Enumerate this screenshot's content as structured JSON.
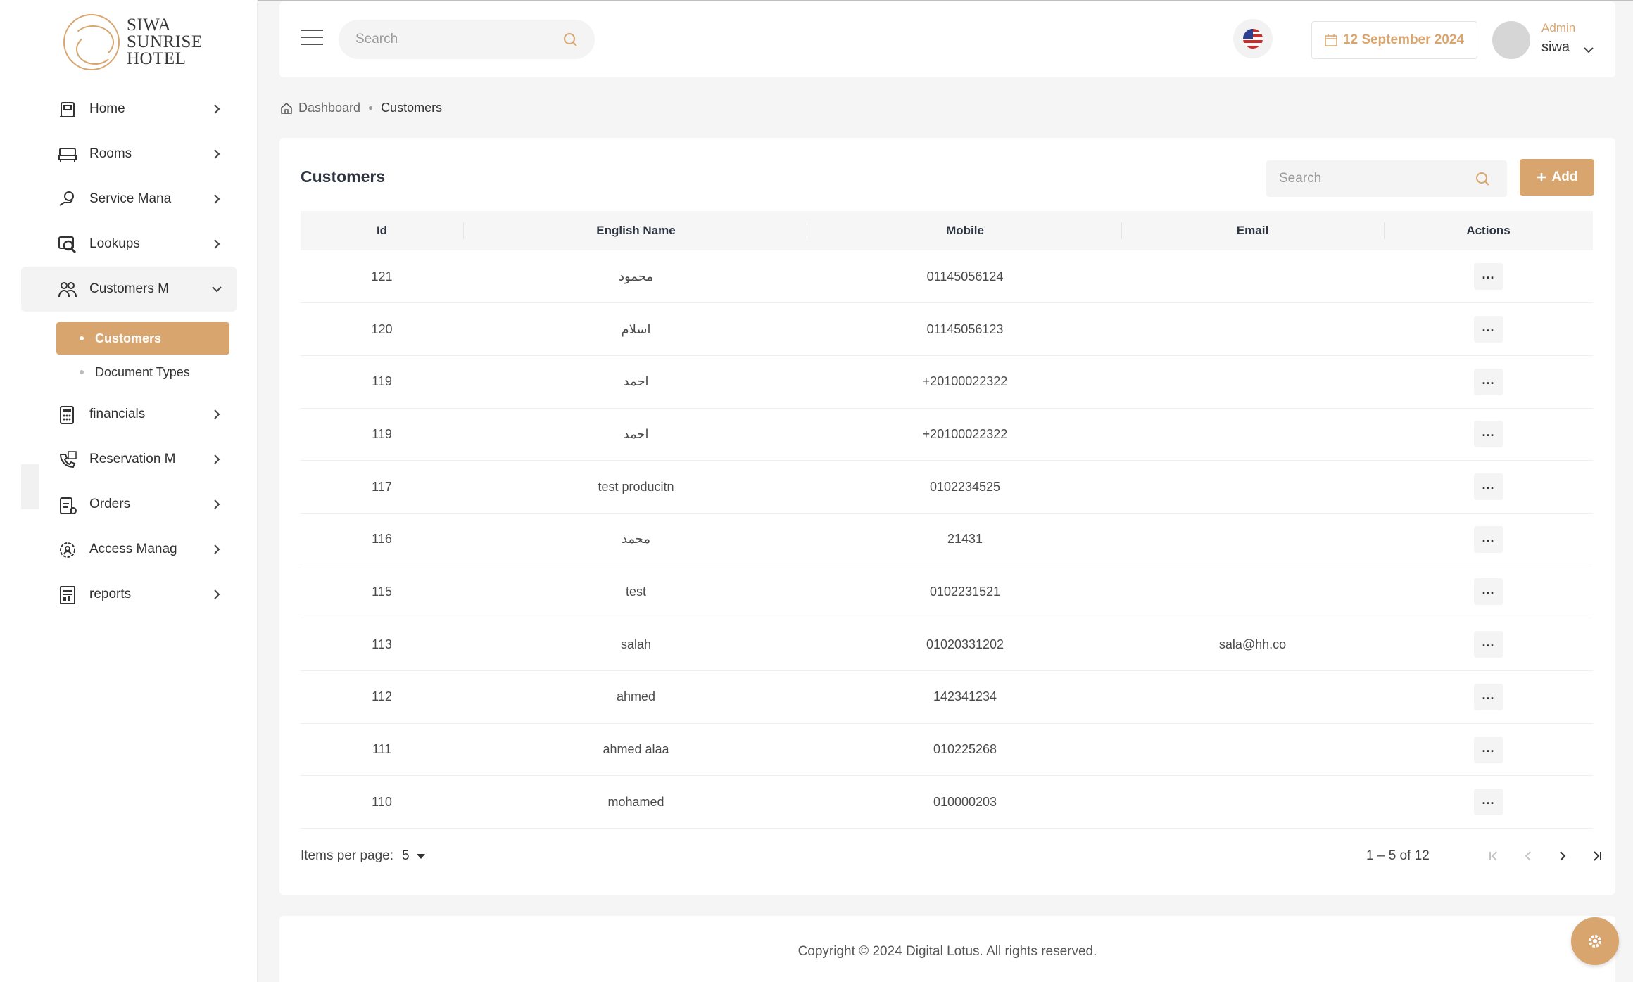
{
  "brand": {
    "logo_lines": [
      "SIWA",
      "SUNRISE",
      "HOTEL"
    ]
  },
  "sidebar": {
    "items": [
      {
        "label": "Home",
        "icon": "home-icon"
      },
      {
        "label": "Rooms",
        "icon": "bed-icon"
      },
      {
        "label": "Service Mana",
        "icon": "service-hand-icon"
      },
      {
        "label": "Lookups",
        "icon": "lookup-icon"
      },
      {
        "label": "Customers M",
        "icon": "customers-icon",
        "open": true
      },
      {
        "label": "financials",
        "icon": "calculator-icon"
      },
      {
        "label": "Reservation M",
        "icon": "phone-calendar-icon"
      },
      {
        "label": "Orders",
        "icon": "clipboard-icon"
      },
      {
        "label": "Access Manag",
        "icon": "gear-person-icon"
      },
      {
        "label": "reports",
        "icon": "report-icon"
      }
    ],
    "sub_items": [
      {
        "label": "Customers",
        "active": true
      },
      {
        "label": "Document Types",
        "active": false
      }
    ]
  },
  "topbar": {
    "search_placeholder": "Search",
    "language_flag": "us-flag-icon",
    "date": "12 September 2024",
    "user": {
      "role": "Admin",
      "name": "siwa"
    }
  },
  "breadcrumb": {
    "home": "Dashboard",
    "current": "Customers"
  },
  "card": {
    "title": "Customers",
    "search_placeholder": "Search",
    "add_label": "Add"
  },
  "table": {
    "columns": [
      "Id",
      "English Name",
      "Mobile",
      "Email",
      "Actions"
    ],
    "rows": [
      {
        "id": "121",
        "name": "محمود",
        "mobile": "01145056124",
        "email": ""
      },
      {
        "id": "120",
        "name": "اسلام",
        "mobile": "01145056123",
        "email": ""
      },
      {
        "id": "119",
        "name": "احمد",
        "mobile": "+20100022322",
        "email": ""
      },
      {
        "id": "119",
        "name": "احمد",
        "mobile": "+20100022322",
        "email": ""
      },
      {
        "id": "117",
        "name": "test producitn",
        "mobile": "0102234525",
        "email": ""
      },
      {
        "id": "116",
        "name": "محمد",
        "mobile": "21431",
        "email": ""
      },
      {
        "id": "115",
        "name": "test",
        "mobile": "0102231521",
        "email": ""
      },
      {
        "id": "113",
        "name": "salah",
        "mobile": "01020331202",
        "email": "sala@hh.co"
      },
      {
        "id": "112",
        "name": "ahmed",
        "mobile": "142341234",
        "email": ""
      },
      {
        "id": "111",
        "name": "ahmed alaa",
        "mobile": "010225268",
        "email": ""
      },
      {
        "id": "110",
        "name": "mohamed",
        "mobile": "010000203",
        "email": ""
      }
    ],
    "actions_glyph": "..."
  },
  "paginator": {
    "items_per_page_label": "Items per page:",
    "items_per_page": "5",
    "range": "1 – 5 of 12"
  },
  "footer": {
    "copyright": "Copyright © 2024 Digital Lotus. All rights reserved."
  },
  "colors": {
    "accent": "#d9a56e",
    "text": "#333333",
    "background": "#f5f5f6"
  }
}
